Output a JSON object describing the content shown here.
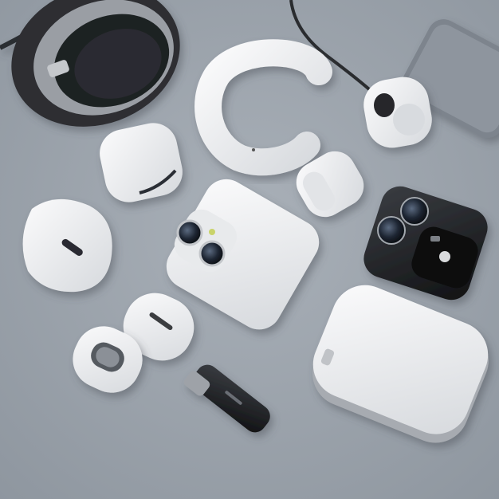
{
  "scene": {
    "background": "#9ca4ad",
    "palette": {
      "white_device": "#f1f2f3",
      "white_shadow": "#c9ccd0",
      "dark_device": "#1c1d20",
      "metal": "#8a8e94",
      "lens": "#2a3340"
    },
    "objects": [
      {
        "name": "headphones",
        "icon": "headphones-icon"
      },
      {
        "name": "smartphone-corner",
        "icon": "phone-icon"
      },
      {
        "name": "ear-hook-earbud",
        "icon": "earbud-icon"
      },
      {
        "name": "cable-earbud",
        "icon": "earbud-icon"
      },
      {
        "name": "earbud-case-left",
        "icon": "case-icon"
      },
      {
        "name": "earbud-single",
        "icon": "earbud-icon"
      },
      {
        "name": "oval-case",
        "icon": "case-icon"
      },
      {
        "name": "white-camera-phone",
        "icon": "phone-icon"
      },
      {
        "name": "black-camera-module",
        "icon": "camera-icon"
      },
      {
        "name": "pill-earbud-a",
        "icon": "earbud-icon"
      },
      {
        "name": "pill-earbud-b",
        "icon": "earbud-icon"
      },
      {
        "name": "usb-dongle",
        "icon": "usb-icon"
      },
      {
        "name": "power-bank",
        "icon": "battery-icon"
      }
    ]
  }
}
